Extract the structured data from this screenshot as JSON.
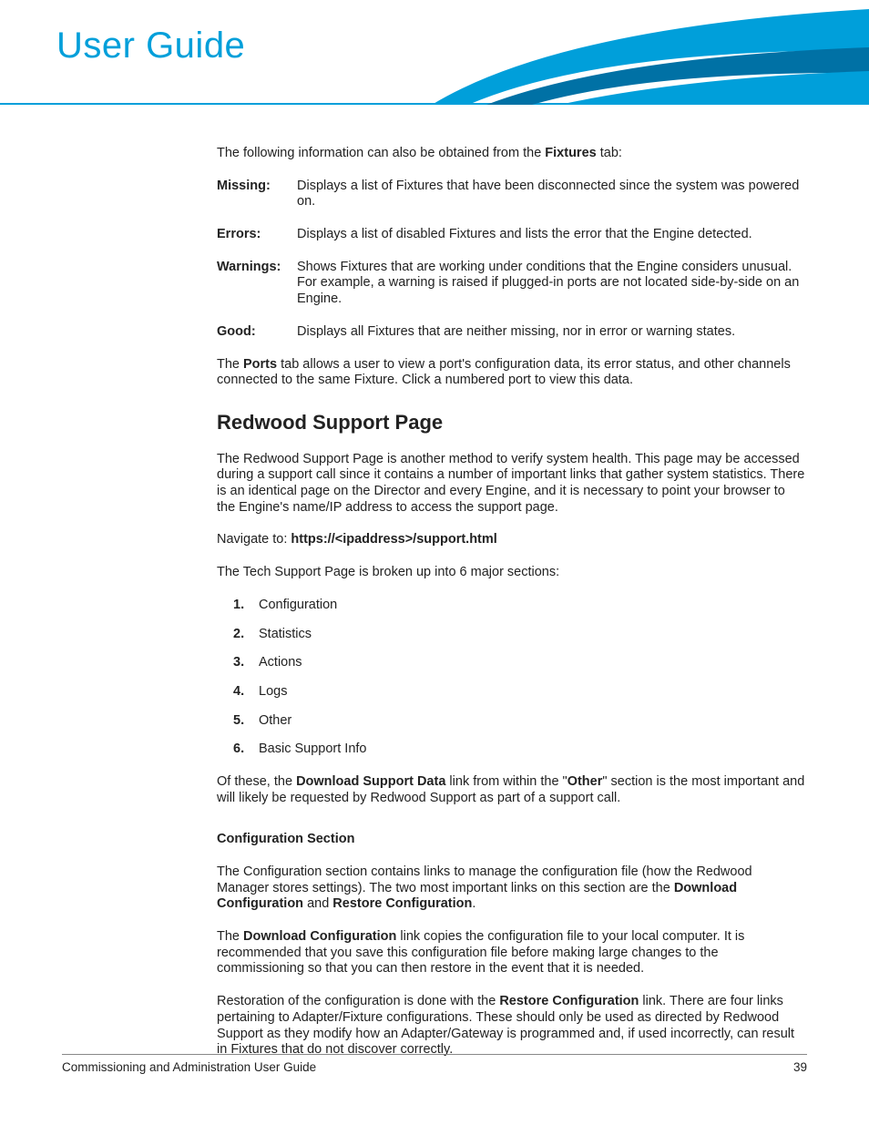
{
  "header": {
    "title": "User Guide"
  },
  "intro": {
    "prefix": "The following information can also be obtained from the ",
    "bold": "Fixtures",
    "suffix": " tab:"
  },
  "defs": [
    {
      "term": "Missing:",
      "desc": "Displays a list of Fixtures that have been disconnected since the system was powered on."
    },
    {
      "term": "Errors:",
      "desc": "Displays a list of disabled Fixtures and lists the error that the Engine detected."
    },
    {
      "term": "Warnings:",
      "desc": "Shows Fixtures that are working under conditions that the Engine considers unusual. For example, a warning is raised if plugged-in ports are not located side-by-side on an Engine."
    },
    {
      "term": "Good:",
      "desc": "Displays all Fixtures that are neither missing, nor in error or warning states."
    }
  ],
  "ports": {
    "prefix": "The ",
    "bold": "Ports",
    "suffix": " tab allows a user to view a port's configuration data, its error status, and other channels connected to the same Fixture. Click a numbered port to view this data."
  },
  "section": {
    "title": "Redwood Support Page",
    "p1": "The Redwood Support Page is another method to verify system health. This page may be accessed during a support call since it contains a number of important links that gather system statistics. There is an identical page on the Director and every Engine, and it is necessary to point your browser to the Engine's name/IP address to access the support page.",
    "nav_prefix": "Navigate to: ",
    "nav_bold": "https://<ipaddress>/support.html",
    "p2": "The Tech Support Page is broken up into 6 major sections:",
    "list": [
      "Configuration",
      "Statistics",
      "Actions",
      "Logs",
      "Other",
      "Basic Support Info"
    ],
    "p3": {
      "t0": "Of these, the ",
      "b1": "Download Support Data",
      "t1": " link from within the \"",
      "b2": "Other",
      "t2": "\" section is the most important and will likely be requested by Redwood Support as part of a support call."
    },
    "sub_heading": "Configuration Section",
    "p4": {
      "t0": "The Configuration section contains links to manage the configuration file (how the Redwood Manager stores settings). The two most important links on this section are the ",
      "b1": "Download Configuration",
      "t1": " and ",
      "b2": "Restore Configuration",
      "t2": "."
    },
    "p5": {
      "t0": "The ",
      "b1": "Download Configuration",
      "t1": " link copies the configuration file to your local computer. It is recommended that you save this configuration file before making large changes to the commissioning so that you can then restore in the event that it is needed."
    },
    "p6": {
      "t0": "Restoration of the configuration is done with the ",
      "b1": "Restore Configuration",
      "t1": " link. There are four links pertaining to Adapter/Fixture configurations. These should only be used as directed by Redwood Support as they modify how an Adapter/Gateway is programmed and, if used incorrectly, can result in Fixtures that do not discover correctly."
    }
  },
  "footer": {
    "left": "Commissioning and Administration User Guide",
    "right": "39"
  }
}
